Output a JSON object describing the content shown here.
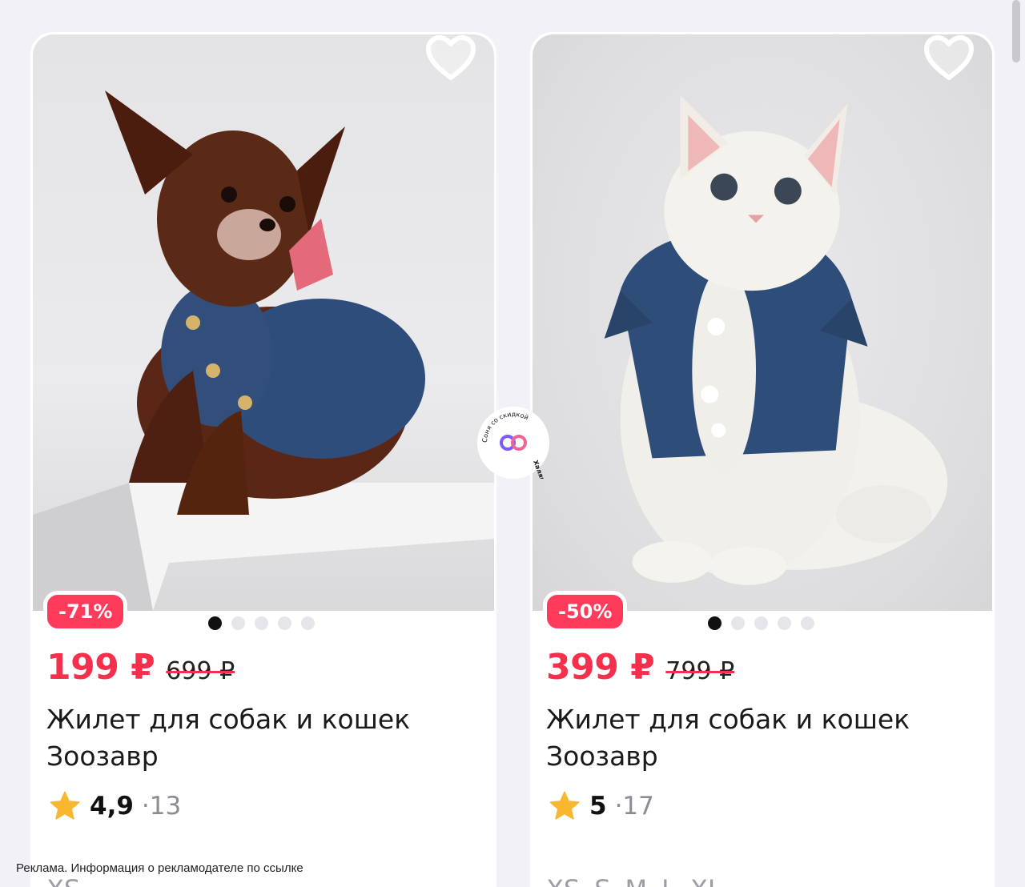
{
  "products": [
    {
      "discount": "-71%",
      "price": "199 ₽",
      "old_price": "699 ₽",
      "title_line1": "Жилет для собак и кошек",
      "title_line2": "Зоозавр",
      "rating": "4,9",
      "reviews": "·13",
      "sizes": [
        "XS"
      ],
      "image_icon": "dog-photo",
      "dots_total": 5,
      "dots_active": 1
    },
    {
      "discount": "-50%",
      "price": "399 ₽",
      "old_price": "799 ₽",
      "title_line1": "Жилет для собак и кошек",
      "title_line2": "Зоозавр",
      "rating": "5",
      "reviews": "·17",
      "sizes": [
        "XS",
        "S",
        "M",
        "L",
        "XL"
      ],
      "image_icon": "cat-photo",
      "dots_total": 5,
      "dots_active": 1
    }
  ],
  "ad_disclaimer": "Реклама. Информация о рекламодателе по ссылке",
  "watermark": {
    "text_top": "Соня со скидкой",
    "text_right": "Халява",
    "icon": "infinity-logo"
  },
  "colors": {
    "accent": "#f5304d",
    "badge": "#ff3b5c",
    "star": "#f7b731",
    "background": "#f2f1f8"
  }
}
